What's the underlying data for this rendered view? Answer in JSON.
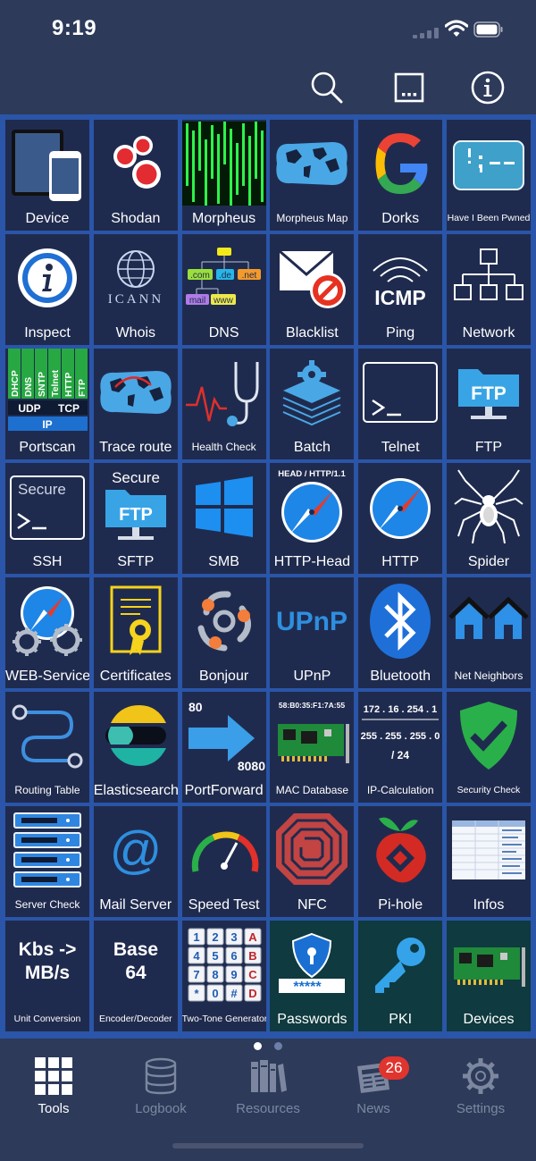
{
  "status": {
    "time": "9:19"
  },
  "colors": {
    "grid_bg": "#2a55a8",
    "tile_bg": "#1f2b4e",
    "teal_tile": "#0f3a3f",
    "badge": "#e0342e",
    "app_bg": "#2d3a5a"
  },
  "toolbar": {
    "search_icon": "search-icon",
    "more_icon": "ellipsis-box-icon",
    "info_icon": "info-icon"
  },
  "tiles": [
    {
      "label": "Device",
      "icon": "device-icon"
    },
    {
      "label": "Shodan",
      "icon": "shodan-icon"
    },
    {
      "label": "Morpheus",
      "icon": "matrix-icon"
    },
    {
      "label": "Morpheus Map",
      "icon": "world-map-icon"
    },
    {
      "label": "Dorks",
      "icon": "google-icon"
    },
    {
      "label": "Have I Been Pwned",
      "icon": "pwned-icon"
    },
    {
      "label": "Inspect",
      "icon": "info-icon"
    },
    {
      "label": "Whois",
      "icon": "icann-icon",
      "text": "ICANN"
    },
    {
      "label": "DNS",
      "icon": "dns-tree-icon",
      "text": {
        "com": ".com",
        "de": ".de",
        "net": ".net",
        "mail": "mail",
        "www": "www"
      }
    },
    {
      "label": "Blacklist",
      "icon": "blocked-mail-icon"
    },
    {
      "label": "Ping",
      "icon": "icmp-icon",
      "text": "ICMP"
    },
    {
      "label": "Network",
      "icon": "network-tree-icon"
    },
    {
      "label": "Portscan",
      "icon": "portscan-icon",
      "text": {
        "ports": [
          "DHCP",
          "DNS",
          "SNTP",
          "Telnet",
          "HTTP",
          "FTP"
        ],
        "udp": "UDP",
        "tcp": "TCP",
        "ip": "IP"
      }
    },
    {
      "label": "Trace route",
      "icon": "trace-map-icon"
    },
    {
      "label": "Health Check",
      "icon": "stethoscope-icon"
    },
    {
      "label": "Batch",
      "icon": "batch-gear-icon"
    },
    {
      "label": "Telnet",
      "icon": "terminal-icon"
    },
    {
      "label": "FTP",
      "icon": "ftp-folder-icon",
      "text": "FTP"
    },
    {
      "label": "SSH",
      "icon": "secure-terminal-icon",
      "text": "Secure"
    },
    {
      "label": "SFTP",
      "icon": "sftp-folder-icon",
      "text": {
        "top": "Secure",
        "folder": "FTP"
      }
    },
    {
      "label": "SMB",
      "icon": "windows-icon"
    },
    {
      "label": "HTTP-Head",
      "icon": "compass-icon",
      "text": "HEAD / HTTP/1.1"
    },
    {
      "label": "HTTP",
      "icon": "compass-icon"
    },
    {
      "label": "Spider",
      "icon": "spider-icon"
    },
    {
      "label": "WEB-Service",
      "icon": "compass-gears-icon"
    },
    {
      "label": "Certificates",
      "icon": "certificate-icon"
    },
    {
      "label": "Bonjour",
      "icon": "bonjour-icon"
    },
    {
      "label": "UPnP",
      "icon": "upnp-icon",
      "text": "UPnP"
    },
    {
      "label": "Bluetooth",
      "icon": "bluetooth-icon"
    },
    {
      "label": "Net Neighbors",
      "icon": "houses-icon"
    },
    {
      "label": "Routing Table",
      "icon": "route-path-icon"
    },
    {
      "label": "Elasticsearch",
      "icon": "elasticsearch-icon"
    },
    {
      "label": "PortForward",
      "icon": "arrow-right-icon",
      "text": {
        "from": "80",
        "to": "8080"
      }
    },
    {
      "label": "MAC Database",
      "icon": "network-card-icon",
      "text": "58:B0:35:F1:7A:55"
    },
    {
      "label": "IP-Calculation",
      "icon": "ip-calc-icon",
      "text": {
        "ip": "172 . 16 . 254 . 1",
        "mask": "255 . 255 . 255 . 0",
        "cidr": "/ 24"
      }
    },
    {
      "label": "Security Check",
      "icon": "shield-check-icon"
    },
    {
      "label": "Server Check",
      "icon": "server-rack-icon"
    },
    {
      "label": "Mail Server",
      "icon": "at-sign-icon",
      "text": "@"
    },
    {
      "label": "Speed Test",
      "icon": "speedometer-icon"
    },
    {
      "label": "NFC",
      "icon": "nfc-icon"
    },
    {
      "label": "Pi-hole",
      "icon": "pihole-icon"
    },
    {
      "label": "Infos",
      "icon": "info-table-icon"
    },
    {
      "label": "Unit Conversion",
      "icon": "unit-text-icon",
      "text": {
        "line1": "Kbs ->",
        "line2": "MB/s"
      }
    },
    {
      "label": "Encoder/Decoder",
      "icon": "base64-text-icon",
      "text": {
        "line1": "Base",
        "line2": "64"
      }
    },
    {
      "label": "Two-Tone Generator",
      "icon": "dtmf-keypad-icon",
      "text": [
        "1",
        "2",
        "3",
        "A",
        "4",
        "5",
        "6",
        "B",
        "7",
        "8",
        "9",
        "C",
        "*",
        "0",
        "#",
        "D"
      ]
    },
    {
      "label": "Passwords",
      "icon": "password-shield-icon",
      "text": "*****"
    },
    {
      "label": "PKI",
      "icon": "key-icon"
    },
    {
      "label": "Devices",
      "icon": "network-card-icon"
    }
  ],
  "pager": {
    "page_count": 2,
    "current_page": 1
  },
  "tabs": [
    {
      "label": "Tools",
      "icon": "grid-icon",
      "active": true
    },
    {
      "label": "Logbook",
      "icon": "database-icon"
    },
    {
      "label": "Resources",
      "icon": "books-icon"
    },
    {
      "label": "News",
      "icon": "newspaper-icon",
      "badge": "26"
    },
    {
      "label": "Settings",
      "icon": "gear-icon"
    }
  ]
}
